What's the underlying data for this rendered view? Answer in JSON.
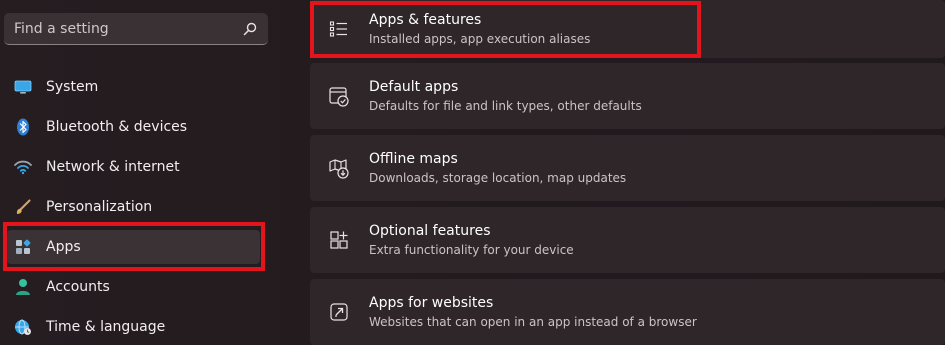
{
  "search": {
    "placeholder": "Find a setting",
    "icon": "search-icon"
  },
  "sidebar": {
    "items": [
      {
        "label": "System",
        "icon": "system-monitor-icon"
      },
      {
        "label": "Bluetooth & devices",
        "icon": "bluetooth-icon"
      },
      {
        "label": "Network & internet",
        "icon": "wifi-icon"
      },
      {
        "label": "Personalization",
        "icon": "paintbrush-icon"
      },
      {
        "label": "Apps",
        "icon": "apps-icon",
        "selected": true
      },
      {
        "label": "Accounts",
        "icon": "person-icon"
      },
      {
        "label": "Time & language",
        "icon": "globe-clock-icon"
      }
    ]
  },
  "main": {
    "cards": [
      {
        "title": "Apps & features",
        "subtitle": "Installed apps, app execution aliases",
        "icon": "list-icon"
      },
      {
        "title": "Default apps",
        "subtitle": "Defaults for file and link types, other defaults",
        "icon": "default-apps-icon"
      },
      {
        "title": "Offline maps",
        "subtitle": "Downloads, storage location, map updates",
        "icon": "map-download-icon"
      },
      {
        "title": "Optional features",
        "subtitle": "Extra functionality for your device",
        "icon": "add-grid-icon"
      },
      {
        "title": "Apps for websites",
        "subtitle": "Websites that can open in an app instead of a browser",
        "icon": "open-external-icon"
      }
    ]
  },
  "colors": {
    "highlight": "#e3141c",
    "background": "#231b1e",
    "card": "#2e2629",
    "accent_blue": "#4cc2ff"
  }
}
